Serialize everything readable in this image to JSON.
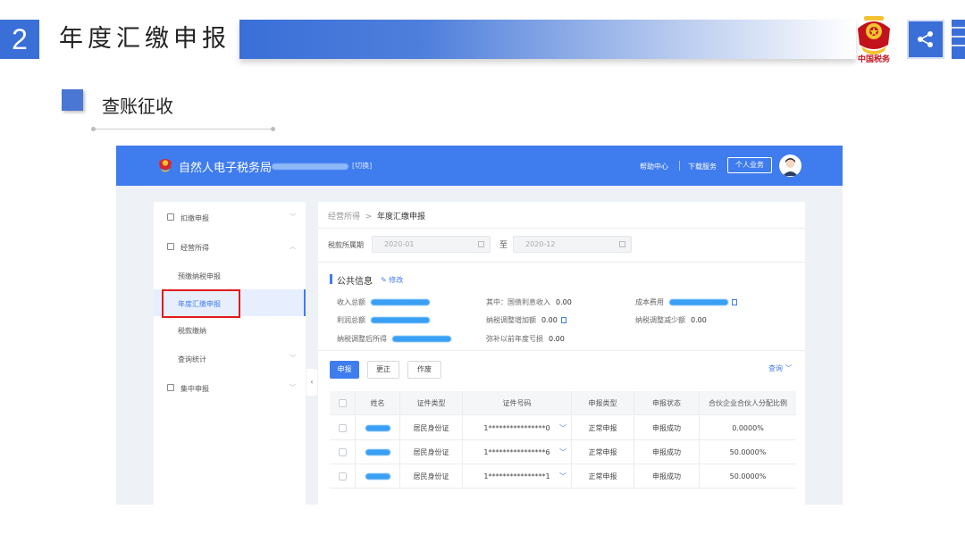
{
  "slide": {
    "section_number": "2",
    "title": "年度汇缴申报",
    "subtitle": "查账征收",
    "emblem_caption": "中国税务"
  },
  "app": {
    "name": "自然人电子税务局",
    "switch_label": "[切换]",
    "nav": {
      "help": "帮助中心",
      "download": "下载服务",
      "personal": "个人业务"
    },
    "sidebar": [
      {
        "label": "扣缴申报",
        "icon": "document-icon",
        "chevron": "﹀"
      },
      {
        "label": "经营所得",
        "icon": "briefcase-icon",
        "chevron": "︿"
      },
      {
        "label": "预缴纳税申报"
      },
      {
        "label": "年度汇缴申报",
        "active": true
      },
      {
        "label": "税款缴纳"
      },
      {
        "label": "查询统计",
        "chevron": "﹀"
      },
      {
        "label": "集中申报",
        "icon": "plus-box-icon",
        "chevron": "﹀"
      }
    ],
    "breadcrumb": {
      "parent": "经营所得",
      "separator": ">",
      "current": "年度汇缴申报"
    },
    "period": {
      "label": "税款所属期",
      "from": "2020-01",
      "to_label": "至",
      "to": "2020-12"
    },
    "public_info": {
      "title": "公共信息",
      "edit": "修改",
      "fields": {
        "income_total": "收入总额",
        "treasury_interest": "其中：国债利息收入",
        "treasury_interest_value": "0.00",
        "cost": "成本费用",
        "profit_total": "利润总额",
        "tax_adjust_increase": "纳税调整增加额",
        "tax_adjust_increase_value": "0.00",
        "tax_adjust_decrease": "纳税调整减少额",
        "tax_adjust_decrease_value": "0.00",
        "adjusted_income": "纳税调整后所得",
        "prior_loss": "弥补以前年度亏损",
        "prior_loss_value": "0.00"
      }
    },
    "actions": {
      "declare": "申报",
      "correct": "更正",
      "void": "作废",
      "query": "查询 ﹀"
    },
    "table": {
      "headers": [
        "姓名",
        "证件类型",
        "证件号码",
        "申报类型",
        "申报状态",
        "合伙企业合伙人分配比例"
      ],
      "rows": [
        {
          "id_type": "居民身份证",
          "id_number": "1****************0",
          "declare_type": "正常申报",
          "status": "申报成功",
          "ratio": "0.0000%"
        },
        {
          "id_type": "居民身份证",
          "id_number": "1****************6",
          "declare_type": "正常申报",
          "status": "申报成功",
          "ratio": "50.0000%"
        },
        {
          "id_type": "居民身份证",
          "id_number": "1****************1",
          "declare_type": "正常申报",
          "status": "申报成功",
          "ratio": "50.0000%"
        }
      ]
    }
  },
  "colors": {
    "accent": "#3a6fd8",
    "app_header": "#3f7cee",
    "highlight_border": "#e01b1b",
    "emblem_red": "#c3121b"
  }
}
